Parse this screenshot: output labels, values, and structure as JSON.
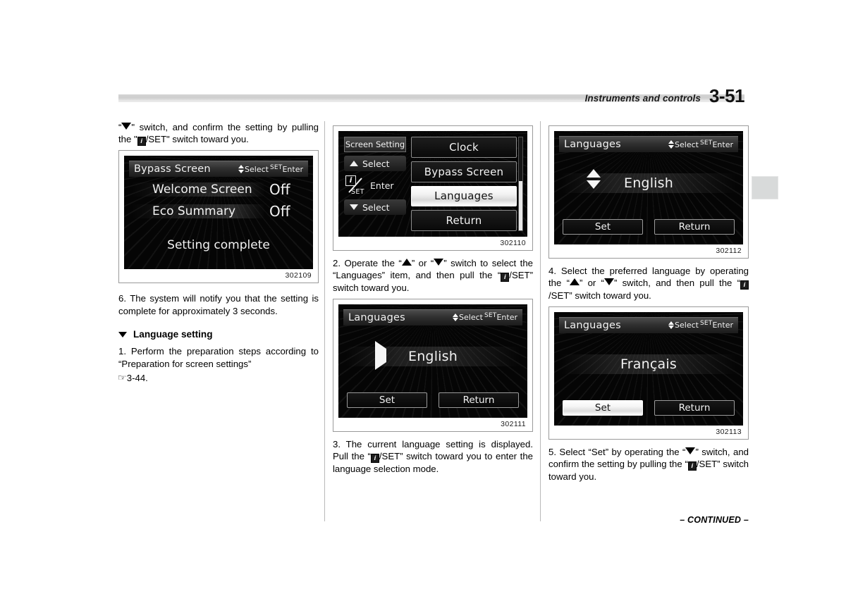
{
  "header": {
    "section_label": "Instruments and controls",
    "page_number": "3-51"
  },
  "left_column": {
    "continuation_text_part1": "\" switch, and confirm the setting by pulling the \"",
    "continuation_text_part2": "/SET\" switch toward you.",
    "figure_1": {
      "id": "302109",
      "title": "Bypass Screen",
      "hint_select": "Select",
      "hint_set": "SET",
      "hint_enter": "Enter",
      "rows": [
        {
          "label": "Welcome Screen",
          "value": "Off"
        },
        {
          "label": "Eco Summary",
          "value": "Off"
        }
      ],
      "message": "Setting complete"
    },
    "step_6": "6. The system will notify you that the setting is complete for approximately 3 seconds.",
    "subheading": "Language setting",
    "step_1_part1": "1. Perform the preparation steps according to “Preparation for screen settings”",
    "step_1_ref": "3-44."
  },
  "middle_column": {
    "figure_2": {
      "id": "302110",
      "side_header": "Screen Setting",
      "side_up_label": "Select",
      "side_down_label": "Select",
      "side_enter_label": "Enter",
      "side_iset_i": "i",
      "side_iset_set": "SET",
      "menu_items": [
        {
          "label": "Clock",
          "selected": false
        },
        {
          "label": "Bypass Screen",
          "selected": false
        },
        {
          "label": "Languages",
          "selected": true
        },
        {
          "label": "Return",
          "selected": false
        }
      ]
    },
    "step_2_a": "2. Operate the “",
    "step_2_b": "” or “",
    "step_2_c": "” switch to select the “Languages” item, and then pull the “",
    "step_2_d": "/SET” switch toward you.",
    "figure_3": {
      "id": "302111",
      "title": "Languages",
      "hint_select": "Select",
      "hint_set": "SET",
      "hint_enter": "Enter",
      "value": "English",
      "marker": "triangle-right",
      "buttons": [
        {
          "label": "Set",
          "selected": false
        },
        {
          "label": "Return",
          "selected": false
        }
      ]
    },
    "step_3_a": "3. The current language setting is displayed. Pull the “",
    "step_3_b": "/SET” switch toward you to enter the language selection mode."
  },
  "right_column": {
    "figure_4": {
      "id": "302112",
      "title": "Languages",
      "hint_select": "Select",
      "hint_set": "SET",
      "hint_enter": "Enter",
      "value": "English",
      "marker": "up-down-arrows",
      "buttons": [
        {
          "label": "Set",
          "selected": false
        },
        {
          "label": "Return",
          "selected": false
        }
      ]
    },
    "step_4_a": "4. Select the preferred language by operating the “",
    "step_4_b": "” or “",
    "step_4_c": "” switch, and then pull the “",
    "step_4_d": "/SET” switch toward you.",
    "figure_5": {
      "id": "302113",
      "title": "Languages",
      "hint_select": "Select",
      "hint_set": "SET",
      "hint_enter": "Enter",
      "value": "Français",
      "marker": "none",
      "buttons": [
        {
          "label": "Set",
          "selected": true
        },
        {
          "label": "Return",
          "selected": false
        }
      ]
    },
    "step_5_a": "5. Select “Set” by operating the “",
    "step_5_b": "” switch, and confirm the setting by pulling the “",
    "step_5_c": "/SET” switch toward you."
  },
  "footer": {
    "continued": "– CONTINUED –"
  }
}
